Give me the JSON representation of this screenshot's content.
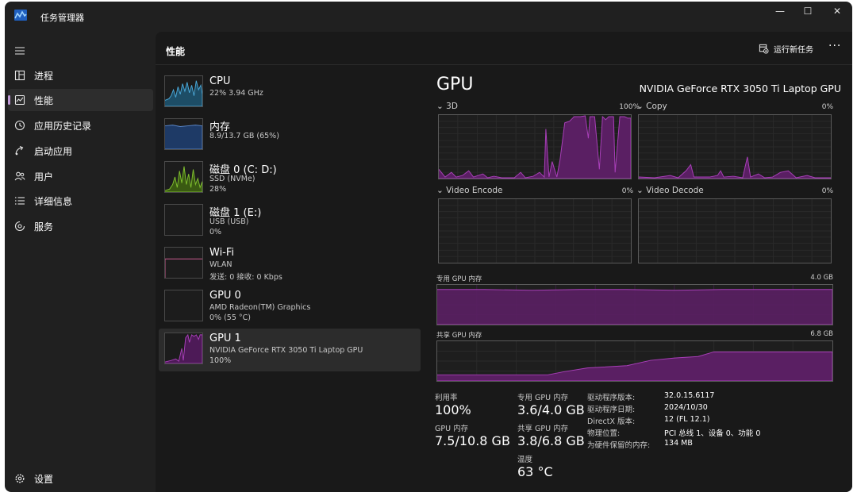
{
  "window": {
    "title": "任务管理器",
    "controls": [
      "—",
      "☐",
      "✕"
    ]
  },
  "sidebar": {
    "items": [
      {
        "label": "进程",
        "icon": "processes-icon"
      },
      {
        "label": "性能",
        "icon": "performance-icon",
        "active": true
      },
      {
        "label": "应用历史记录",
        "icon": "app-history-icon"
      },
      {
        "label": "启动应用",
        "icon": "startup-apps-icon"
      },
      {
        "label": "用户",
        "icon": "users-icon"
      },
      {
        "label": "详细信息",
        "icon": "details-icon"
      },
      {
        "label": "服务",
        "icon": "services-icon"
      }
    ],
    "settings_label": "设置"
  },
  "header": {
    "title": "性能",
    "run_task": "运行新任务",
    "more": "···"
  },
  "resources": [
    {
      "name": "CPU",
      "line1": "22% 3.94 GHz",
      "line2": "",
      "color": "#4aa8d8"
    },
    {
      "name": "内存",
      "line1": "8.9/13.7 GB (65%)",
      "line2": "",
      "color": "#5b87c9"
    },
    {
      "name": "磁盘 0 (C: D:)",
      "line1": "SSD (NVMe)",
      "line2": "28%",
      "color": "#7fbf2e"
    },
    {
      "name": "磁盘 1 (E:)",
      "line1": "USB (USB)",
      "line2": "0%",
      "color": "#7fbf2e"
    },
    {
      "name": "Wi-Fi",
      "line1": "WLAN",
      "line2": "发送: 0 接收: 0 Kbps",
      "color": "#c75a8e"
    },
    {
      "name": "GPU 0",
      "line1": "AMD Radeon(TM) Graphics",
      "line2": "0% (55 °C)",
      "color": "#a83fb8"
    },
    {
      "name": "GPU 1",
      "line1": "NVIDIA GeForce RTX 3050 Ti Laptop GPU",
      "line2": "100%",
      "color": "#a83fb8",
      "active": true
    }
  ],
  "detail": {
    "title": "GPU",
    "model": "NVIDIA GeForce RTX 3050 Ti Laptop GPU",
    "engines": [
      {
        "label": "3D",
        "pct": "100%"
      },
      {
        "label": "Copy",
        "pct": "0%"
      },
      {
        "label": "Video Encode",
        "pct": "0%"
      },
      {
        "label": "Video Decode",
        "pct": "0%"
      }
    ],
    "dedicated": {
      "label": "专用 GPU 内存",
      "max": "4.0 GB"
    },
    "shared": {
      "label": "共享 GPU 内存",
      "max": "6.8 GB"
    },
    "stats": {
      "util_label": "利用率",
      "util_value": "100%",
      "gpu_mem_label": "GPU 内存",
      "gpu_mem_value": "7.5/10.8 GB",
      "ded_label": "专用 GPU 内存",
      "ded_value": "3.6/4.0 GB",
      "shared_label": "共享 GPU 内存",
      "shared_value": "3.8/6.8 GB",
      "temp_label": "温度",
      "temp_value": "63 °C"
    },
    "info": [
      {
        "key": "驱动程序版本:",
        "value": "32.0.15.6117"
      },
      {
        "key": "驱动程序日期:",
        "value": "2024/10/30"
      },
      {
        "key": "DirectX 版本:",
        "value": "12 (FL 12.1)"
      },
      {
        "key": "物理位置:",
        "value": "PCI 总线 1、设备 0、功能 0"
      },
      {
        "key": "为硬件保留的内存:",
        "value": "134 MB"
      }
    ]
  },
  "colors": {
    "accent": "#c19bd8",
    "gpu_line": "#a83fb8",
    "gpu_fill": "#5a1f63"
  }
}
